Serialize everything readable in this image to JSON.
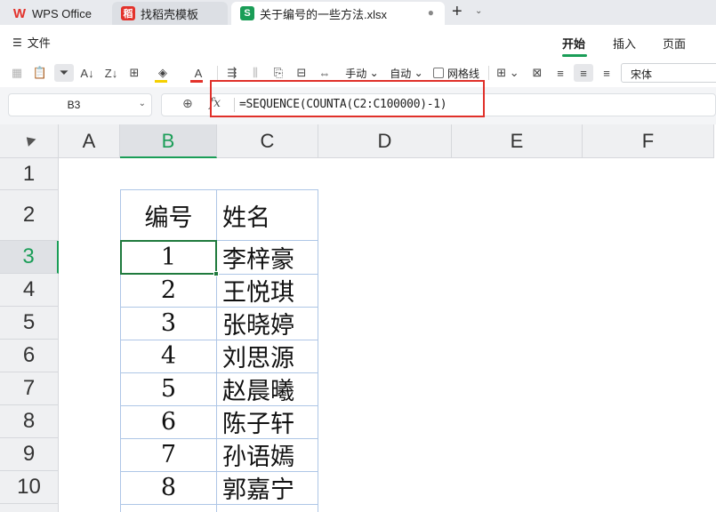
{
  "tabs": [
    {
      "label": "WPS Office",
      "icon": "wps-logo-icon"
    },
    {
      "label": "找稻壳模板",
      "icon": "docer-logo-icon"
    },
    {
      "label": "关于编号的一些方法.xlsx",
      "icon": "sheet-logo-icon",
      "active": true
    }
  ],
  "menubar": {
    "file_label": "文件",
    "tabs": [
      "开始",
      "插入",
      "页面"
    ],
    "active_tab": "开始"
  },
  "toolbar": {
    "wrap_label": "手动",
    "auto_label": "自动",
    "gridlines_label": "网格线",
    "font_name": "宋体"
  },
  "formula_bar": {
    "cell_ref": "B3",
    "fx_label": "fx",
    "formula": "=SEQUENCE(COUNTA(C2:C100000)-1)"
  },
  "grid": {
    "columns": [
      "A",
      "B",
      "C",
      "D",
      "E",
      "F"
    ],
    "selected_column": "B",
    "rows": [
      "1",
      "2",
      "3",
      "4",
      "5",
      "6",
      "7",
      "8",
      "9",
      "10"
    ],
    "selected_row": "3"
  },
  "table": {
    "header_number": "编号",
    "header_name": "姓名",
    "rows": [
      {
        "num": "1",
        "name": "李梓豪"
      },
      {
        "num": "2",
        "name": "王悦琪"
      },
      {
        "num": "3",
        "name": "张晓婷"
      },
      {
        "num": "4",
        "name": "刘思源"
      },
      {
        "num": "5",
        "name": "赵晨曦"
      },
      {
        "num": "6",
        "name": "陈子轩"
      },
      {
        "num": "7",
        "name": "孙语嫣"
      },
      {
        "num": "8",
        "name": "郭嘉宁"
      }
    ]
  },
  "colors": {
    "accent": "#1a9d57",
    "highlight_border": "#e0302a"
  }
}
